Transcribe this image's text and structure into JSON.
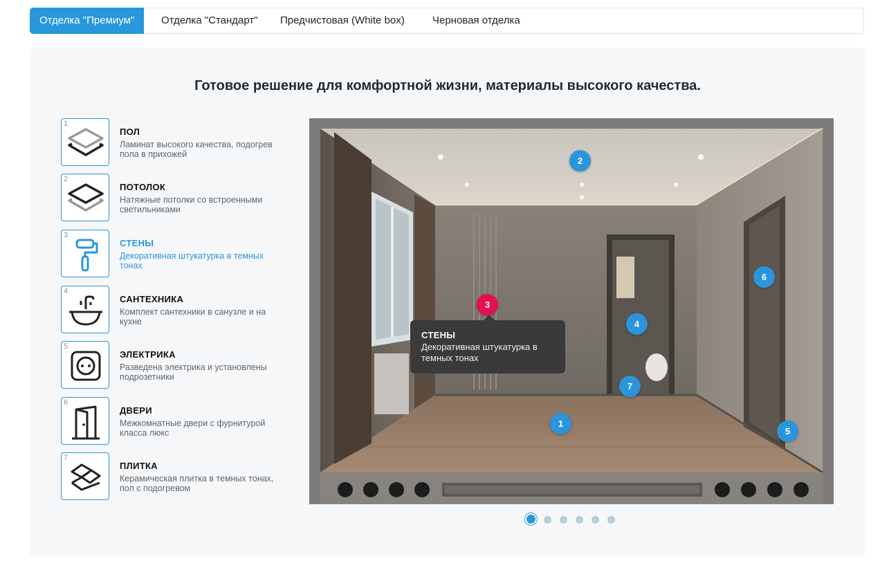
{
  "tabs": [
    {
      "label": "Отделка \"Премиум\"",
      "active": true
    },
    {
      "label": "Отделка \"Стандарт\"",
      "active": false
    },
    {
      "label": "Предчистовая (White box)",
      "active": false
    },
    {
      "label": "Черновая отделка",
      "active": false
    }
  ],
  "headline": "Готовое решение для комфортной жизни, материалы высокого качества.",
  "features": [
    {
      "num": "1",
      "title": "ПОЛ",
      "desc": "Ламинат высокого качества, подогрев пола в прихожей",
      "icon": "floor-layers-icon"
    },
    {
      "num": "2",
      "title": "ПОТОЛОК",
      "desc": "Натяжные потолки со встроенными светильниками",
      "icon": "ceiling-layers-icon"
    },
    {
      "num": "3",
      "title": "СТЕНЫ",
      "desc": "Декоративная штукатурка в темных тонах",
      "icon": "paint-roller-icon",
      "active": true
    },
    {
      "num": "4",
      "title": "САНТЕХНИКА",
      "desc": "Комплект сантехники в санузле и на кухне",
      "icon": "faucet-sink-icon"
    },
    {
      "num": "5",
      "title": "ЭЛЕКТРИКА",
      "desc": "Разведена электрика и установлены подрозетники",
      "icon": "power-socket-icon"
    },
    {
      "num": "6",
      "title": "ДВЕРИ",
      "desc": "Межкомнатные двери с фурнитурой класса люкс",
      "icon": "door-icon"
    },
    {
      "num": "7",
      "title": "ПЛИТКА",
      "desc": "Керамическая плитка в темных тонах, пол с подогревом",
      "icon": "tiles-icon"
    }
  ],
  "pins": [
    "1",
    "2",
    "3",
    "4",
    "5",
    "6",
    "7"
  ],
  "tooltip": {
    "title": "СТЕНЫ",
    "desc": "Декоративная штукатурка в темных тонах"
  },
  "slider": {
    "count": 6,
    "active": 1
  },
  "colors": {
    "accent": "#2997dc",
    "active_pin": "#e5104f",
    "tooltip_bg": "#3a3a3a",
    "panel_bg": "#f6f7f8"
  }
}
